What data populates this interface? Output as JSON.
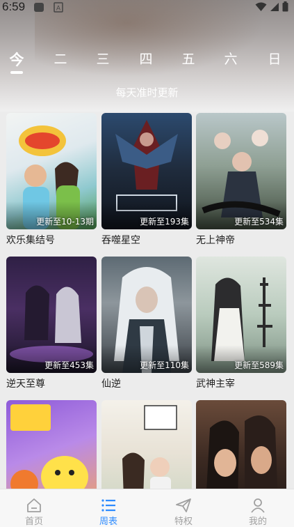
{
  "status": {
    "time": "6:59"
  },
  "days": [
    "今",
    "二",
    "三",
    "四",
    "五",
    "六",
    "日"
  ],
  "subtitle": "每天准时更新",
  "shows": [
    {
      "title": "欢乐集结号",
      "badge": "更新至10-13期"
    },
    {
      "title": "吞噬星空",
      "badge": "更新至193集"
    },
    {
      "title": "无上神帝",
      "badge": "更新至534集"
    },
    {
      "title": "逆天至尊",
      "badge": "更新至453集"
    },
    {
      "title": "仙逆",
      "badge": "更新至110集"
    },
    {
      "title": "武神主宰",
      "badge": "更新至589集"
    },
    {
      "title": "",
      "badge": ""
    },
    {
      "title": "",
      "badge": ""
    },
    {
      "title": "",
      "badge": ""
    }
  ],
  "nav": [
    {
      "label": "首页",
      "icon": "home-icon"
    },
    {
      "label": "周表",
      "icon": "list-icon"
    },
    {
      "label": "特权",
      "icon": "send-icon"
    },
    {
      "label": "我的",
      "icon": "user-icon"
    }
  ],
  "colors": {
    "accent": "#2f8cff",
    "inactive": "#a0a0a0"
  }
}
